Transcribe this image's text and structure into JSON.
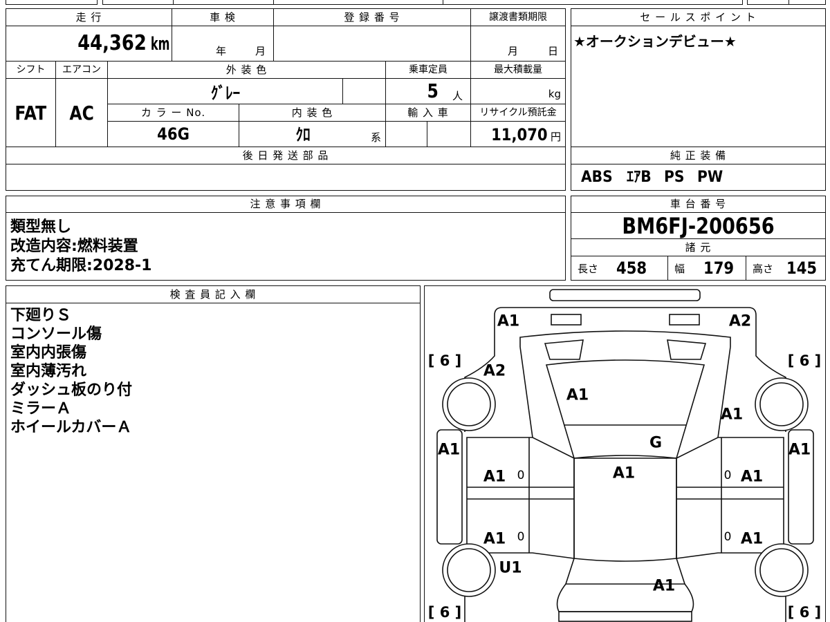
{
  "main": {
    "mileage": {
      "header": "走 行",
      "value": "44,362",
      "unit": "km"
    },
    "inspection": {
      "header": "車 検",
      "year_label": "年",
      "month_label": "月"
    },
    "registration": {
      "header": "登 録 番 号"
    },
    "transfer_deadline": {
      "header": "譲渡書類期限",
      "month_label": "月",
      "day_label": "日"
    },
    "shift": {
      "header": "シフト",
      "value": "FAT"
    },
    "aircon": {
      "header": "エアコン",
      "value": "AC"
    },
    "exterior_color": {
      "header": "外 装 色",
      "value": "ｸﾞﾚｰ"
    },
    "capacity": {
      "header": "乗車定員",
      "value": "5",
      "unit": "人"
    },
    "max_load": {
      "header": "最大積載量",
      "unit": "kg"
    },
    "color_no": {
      "header": "カ ラ ー No.",
      "value": "46G"
    },
    "interior_color": {
      "header": "内 装 色",
      "value": "ｸﾛ",
      "suffix": "系"
    },
    "imported": {
      "header": "輸 入 車"
    },
    "recycle_fee": {
      "header": "リサイクル預託金",
      "value": "11,070",
      "unit": "円"
    },
    "later_parts": {
      "header": "後 日 発 送 部 品"
    }
  },
  "sales_point": {
    "header": "セ ー ル ス ポ イ ン ト",
    "text": "★オークションデビュー★"
  },
  "factory_equipment": {
    "header": "純 正 装 備",
    "items": [
      "ABS",
      "ｴｱB",
      "PS",
      "PW"
    ]
  },
  "notes": {
    "header": "注 意 事 項 欄",
    "lines": [
      "類型無し",
      "改造内容:燃料装置",
      "充てん期限:2028-1"
    ]
  },
  "chassis": {
    "header": "車 台 番 号",
    "value": "BM6FJ-200656"
  },
  "specs": {
    "header": "諸 元",
    "length_label": "長さ",
    "length": "458",
    "width_label": "幅",
    "width": "179",
    "height_label": "高さ",
    "height": "145"
  },
  "inspector": {
    "header": "検 査 員 記 入 欄",
    "lines": [
      "下廻りＳ",
      "コンソール傷",
      "室内内張傷",
      "室内薄汚れ",
      "ダッシュ板のり付",
      "ミラーＡ",
      "ホイールカバーＡ"
    ]
  },
  "car_diagram": {
    "front_left": "A1",
    "front_right": "A2",
    "tire_front_left": "[ 6 ]",
    "tire_front_right": "[ 6 ]",
    "fender_left": "A2",
    "hood": "A1",
    "fender_right": "A1",
    "windshield": "G",
    "side_left": "A1",
    "side_right": "A1",
    "roof": "A1",
    "door_front_left": "A1",
    "door_front_left_mark": "0",
    "door_front_right_mark": "0",
    "door_front_right": "A1",
    "door_rear_left": "A1",
    "door_rear_left_mark": "0",
    "door_rear_right_mark": "0",
    "door_rear_right": "A1",
    "quarter_left": "U1",
    "rear": "A1",
    "tire_rear_left": "[ 6 ]",
    "tire_rear_right": "[ 6 ]"
  }
}
